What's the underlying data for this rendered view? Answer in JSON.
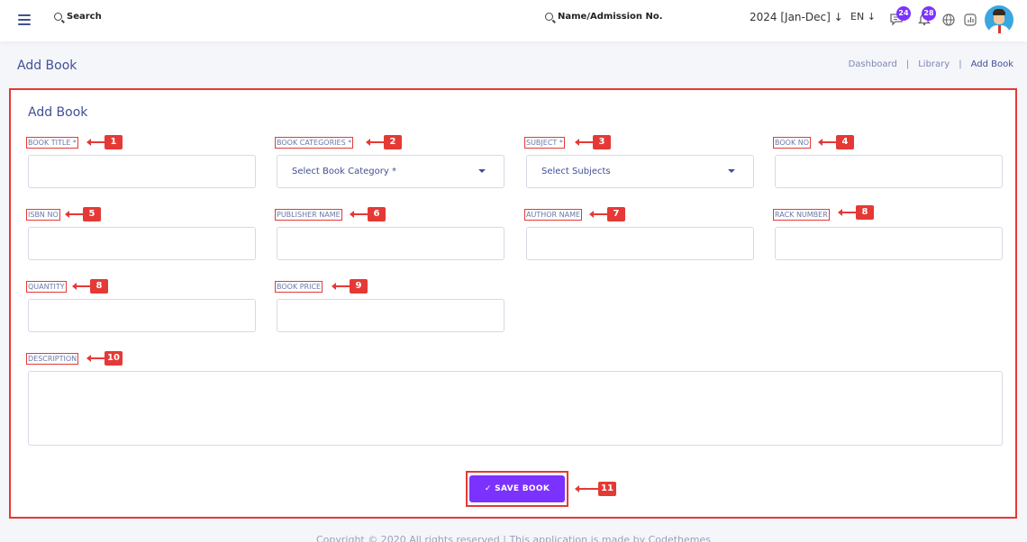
{
  "topbar": {
    "search_label": "Search",
    "student_search_label": "Name/Admission No.",
    "session": "2024 [Jan-Dec]",
    "language": "EN",
    "messages_badge": "24",
    "notifications_badge": "28"
  },
  "page": {
    "title": "Add Book",
    "breadcrumb": [
      "Dashboard",
      "Library",
      "Add Book"
    ]
  },
  "form": {
    "title": "Add Book",
    "fields": {
      "book_title": {
        "label": "BOOK TITLE *",
        "marker": "1"
      },
      "book_category": {
        "label": "BOOK CATEGORIES *",
        "marker": "2",
        "placeholder": "Select Book Category *"
      },
      "subject": {
        "label": "SUBJECT *",
        "marker": "3",
        "placeholder": "Select Subjects"
      },
      "book_no": {
        "label": "BOOK NO",
        "marker": "4"
      },
      "isbn_no": {
        "label": "ISBN NO",
        "marker": "5"
      },
      "publisher_name": {
        "label": "PUBLISHER NAME",
        "marker": "6"
      },
      "author_name": {
        "label": "AUTHOR NAME",
        "marker": "7"
      },
      "rack_number": {
        "label": "RACK NUMBER",
        "marker": "8"
      },
      "quantity": {
        "label": "QUANTITY",
        "marker": "8"
      },
      "book_price": {
        "label": "BOOK PRICE",
        "marker": "9"
      },
      "description": {
        "label": "DESCRIPTION",
        "marker": "10"
      }
    },
    "save_button": {
      "label": "SAVE BOOK",
      "marker": "11"
    }
  },
  "footer": {
    "text": "Copyright © 2020 All rights reserved | This application is made by Codethemes"
  },
  "colors": {
    "accent": "#7c32ff",
    "annotation": "#e53935",
    "text": "#415094"
  },
  "icons": {
    "menu": "hamburger-icon",
    "search": "search-icon",
    "messages": "chat-icon",
    "notifications": "bell-icon",
    "globe": "globe-icon",
    "stats": "chart-icon"
  }
}
